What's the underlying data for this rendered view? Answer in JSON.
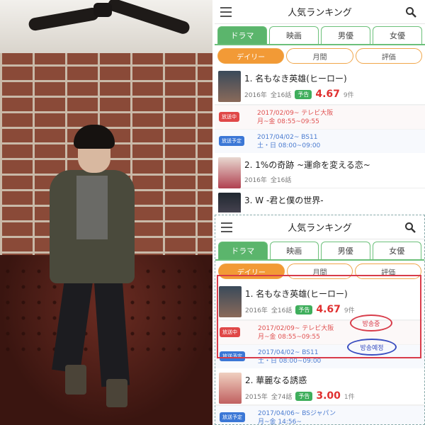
{
  "app": {
    "header_title": "人気ランキング",
    "category_tabs": [
      "ドラマ",
      "映画",
      "男優",
      "女優"
    ],
    "period_tabs": [
      "デイリー",
      "月間",
      "評価"
    ],
    "preview_label": "予告",
    "airing_label": "放送中",
    "upcoming_label": "放送予定"
  },
  "top_panel": {
    "items": [
      {
        "name": "1. 名もなき英雄(ヒーロー)",
        "year": "2016年",
        "episodes": "全16話",
        "score": "4.67",
        "count": "9件",
        "slots": [
          {
            "type": "airing",
            "line1": "2017/02/09~ テレビ大阪",
            "line2": "月~金 08:55~09:55"
          },
          {
            "type": "upcoming",
            "line1": "2017/04/02~ BS11",
            "line2": "土・日 08:00~09:00"
          }
        ]
      },
      {
        "name": "2. 1%の奇跡 ~運命を変える恋~",
        "year": "2016年",
        "episodes": "全16話"
      },
      {
        "name": "3. W -君と僕の世界-"
      }
    ]
  },
  "bottom_panel": {
    "items": [
      {
        "name": "1. 名もなき英雄(ヒーロー)",
        "year": "2016年",
        "episodes": "全16話",
        "score": "4.67",
        "count": "9件",
        "slots": [
          {
            "type": "airing",
            "line1": "2017/02/09~ テレビ大阪",
            "line2": "月~金 08:55~09:55"
          },
          {
            "type": "upcoming",
            "line1": "2017/04/02~ BS11",
            "line2": "土・日 08:00~09:00"
          }
        ]
      },
      {
        "name": "2. 華麗なる誘惑",
        "year": "2015年",
        "episodes": "全74話",
        "score": "3.00",
        "count": "1件",
        "slots": [
          {
            "type": "upcoming",
            "line1": "2017/04/06~ BSジャパン",
            "line2": "月~金 14:56~"
          }
        ]
      }
    ],
    "annotations": {
      "airing": "방송중",
      "upcoming": "방송예정"
    }
  },
  "colors": {
    "green": "#5bb56c",
    "orange": "#f29a36",
    "score_red": "#e03030",
    "annotation_red": "#d83c4a",
    "annotation_blue": "#3a4ec0"
  }
}
